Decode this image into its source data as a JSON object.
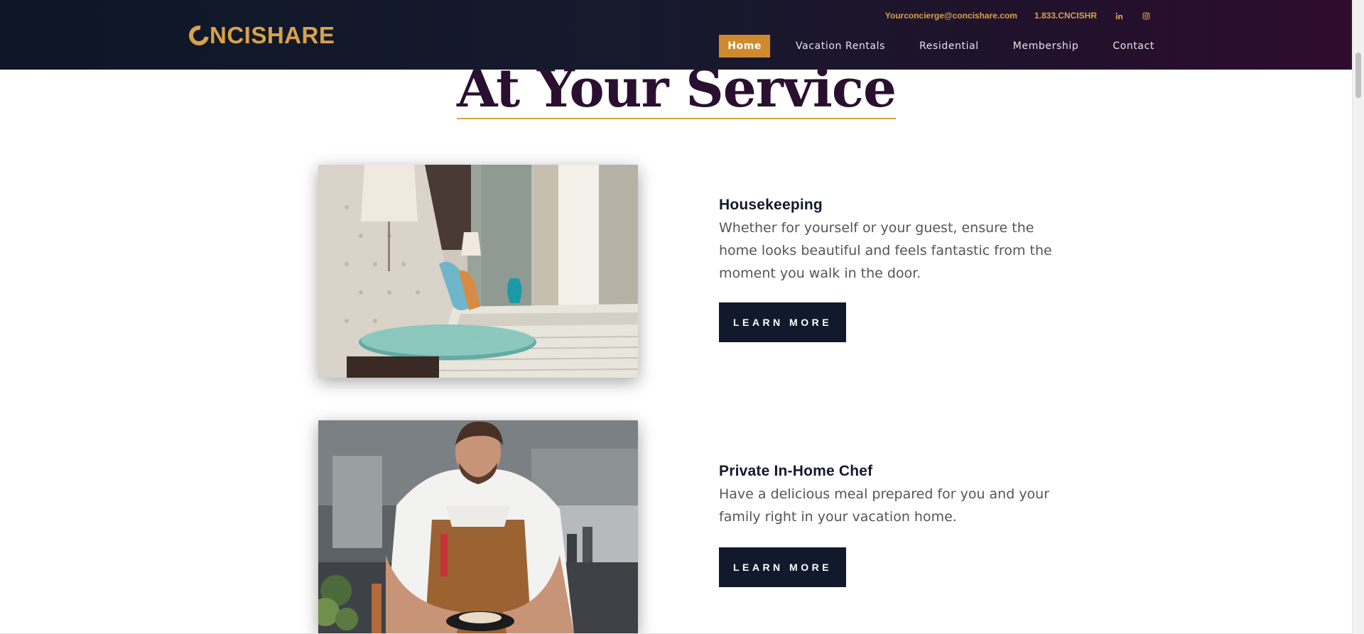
{
  "brand": {
    "logo_text": "NCISHARE",
    "logo_lead": "C"
  },
  "topbar": {
    "email": "Yourconcierge@concishare.com",
    "phone": "1.833.CNCISHR",
    "social": [
      "linkedin-icon",
      "instagram-icon"
    ]
  },
  "nav": {
    "items": [
      {
        "label": "Home",
        "active": true
      },
      {
        "label": "Vacation Rentals",
        "active": false
      },
      {
        "label": "Residential",
        "active": false
      },
      {
        "label": "Membership",
        "active": false
      },
      {
        "label": "Contact",
        "active": false
      }
    ]
  },
  "section": {
    "title": "At Your Service"
  },
  "services": [
    {
      "title": "Housekeeping",
      "description": "Whether for yourself or your guest, ensure the home looks beautiful and feels fantastic from the moment you walk in the door.",
      "button": "LEARN MORE",
      "image": "bedroom-photo"
    },
    {
      "title": "Private In-Home Chef",
      "description": "Have a delicious meal prepared for you and your family right in your vacation home.",
      "button": "LEARN MORE",
      "image": "chef-photo"
    }
  ],
  "colors": {
    "accent": "#d9a24a",
    "active_nav": "#d08a2e",
    "header_start": "#0e1627",
    "header_end": "#2f0c2e",
    "title": "#2a1030",
    "button": "#111a2c"
  }
}
